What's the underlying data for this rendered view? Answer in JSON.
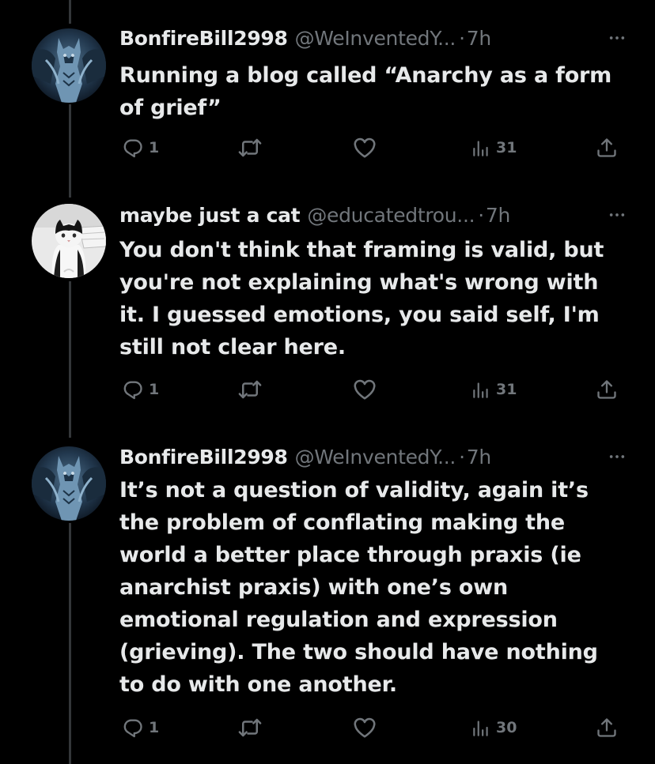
{
  "theme": {
    "background": "#000000",
    "text_primary": "#e7e9ea",
    "text_secondary": "#71767b",
    "thread_line": "#333639"
  },
  "tweets": [
    {
      "display_name": "BonfireBill2998",
      "handle": "@WeInventedY...",
      "separator": "·",
      "time": "7h",
      "text": "Running a blog called “Anarchy as a form of grief”",
      "reply_count": "1",
      "views_count": "31",
      "avatar_icon": "demon-statue-avatar"
    },
    {
      "display_name": "maybe just a cat",
      "handle": "@educatedtrou...",
      "separator": "·",
      "time": "7h",
      "text": "You don't think that framing is valid, but you're not explaining what's wrong with it. I guessed emotions, you said self, I'm still not clear here.",
      "reply_count": "1",
      "views_count": "31",
      "avatar_icon": "cat-avatar"
    },
    {
      "display_name": "BonfireBill2998",
      "handle": "@WeInventedY...",
      "separator": "·",
      "time": "7h",
      "text": "It’s not a question of validity, again it’s the problem of conflating making the world a better place through praxis (ie anarchist praxis) with one’s own emotional regulation and expression (grieving). The two should have nothing to do with one another.",
      "reply_count": "1",
      "views_count": "30",
      "avatar_icon": "demon-statue-avatar"
    }
  ]
}
